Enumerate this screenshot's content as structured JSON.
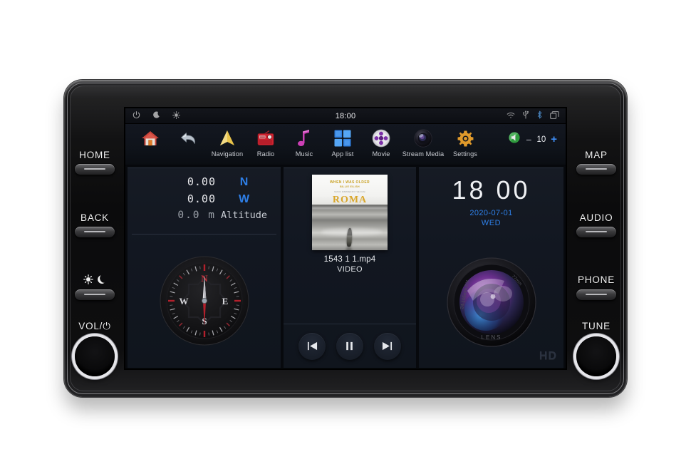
{
  "device": {
    "left_controls": [
      {
        "label": "HOME",
        "type": "button"
      },
      {
        "label": "BACK",
        "type": "button"
      },
      {
        "label": "",
        "type": "button",
        "icon": "sun-moon-icon"
      },
      {
        "label": "VOL/⏻",
        "type": "knob"
      }
    ],
    "right_controls": [
      {
        "label": "MAP",
        "type": "button"
      },
      {
        "label": "AUDIO",
        "type": "button"
      },
      {
        "label": "PHONE",
        "type": "button"
      },
      {
        "label": "TUNE",
        "type": "knob"
      }
    ]
  },
  "statusbar": {
    "clock": "18:00",
    "left_icons": [
      "power-icon",
      "moon-icon",
      "sun-icon"
    ],
    "right_icons": [
      "wifi-icon",
      "usb-icon",
      "bluetooth-icon",
      "recent-apps-icon"
    ]
  },
  "dock": {
    "items": [
      {
        "label": "",
        "icon": "home-icon"
      },
      {
        "label": "",
        "icon": "back-arrow-icon"
      },
      {
        "label": "Navigation",
        "icon": "navigation-icon"
      },
      {
        "label": "Radio",
        "icon": "radio-icon"
      },
      {
        "label": "Music",
        "icon": "music-note-icon"
      },
      {
        "label": "App list",
        "icon": "app-grid-icon"
      },
      {
        "label": "Movie",
        "icon": "movie-disc-icon"
      },
      {
        "label": "Stream Media",
        "icon": "stream-media-icon"
      },
      {
        "label": "Settings",
        "icon": "gear-icon"
      }
    ],
    "volume": {
      "icon": "speaker-icon",
      "minus": "−",
      "value": "10",
      "plus": "+"
    }
  },
  "panels": {
    "gps": {
      "rows": [
        {
          "value": "0.00",
          "label": "N"
        },
        {
          "value": "0.00",
          "label": "W"
        },
        {
          "value": "0.0 m",
          "label": "Altitude"
        }
      ],
      "compass": {
        "north": "N",
        "east": "E",
        "south": "S",
        "west": "W"
      }
    },
    "media": {
      "cover": {
        "line1": "WHEN I WAS OLDER",
        "line2": "BILLIE EILISH",
        "line3": "MUSIC INSPIRED BY THE FILM",
        "line4": "ROMA"
      },
      "track_name": "1543 1 1.mp4",
      "track_kind": "VIDEO",
      "controls": [
        {
          "name": "previous-track-button",
          "icon": "skip-back-icon"
        },
        {
          "name": "pause-button",
          "icon": "pause-icon"
        },
        {
          "name": "next-track-button",
          "icon": "skip-forward-icon"
        }
      ]
    },
    "clock": {
      "time": "18  00",
      "date": "2020-07-01",
      "day": "WED"
    },
    "camera": {
      "lens_text": "LENS",
      "badge": "HD"
    }
  },
  "colors": {
    "accent_blue": "#2e7fe8",
    "screen_bg": "#0e1319",
    "panel_bg": "#121721",
    "compass_red": "#b3202c",
    "gold": "#d9a62a"
  }
}
